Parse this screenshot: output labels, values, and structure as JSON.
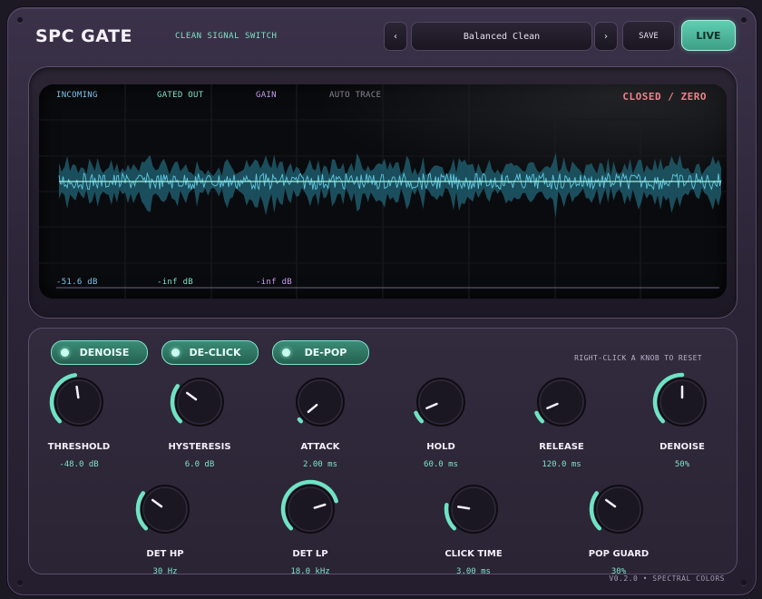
{
  "header": {
    "title": "SPC GATE",
    "subtitle": "CLEAN SIGNAL SWITCH",
    "prev_icon": "chevron-left-icon",
    "prev_label": "‹",
    "preset": "Balanced Clean",
    "next_icon": "chevron-right-icon",
    "next_label": "›",
    "save_label": "SAVE",
    "live_label": "LIVE"
  },
  "scope": {
    "labels": {
      "incoming": "INCOMING",
      "gated_out": "GATED OUT",
      "gain": "GAIN",
      "auto_trace": "AUTO TRACE"
    },
    "state": "CLOSED / ZERO",
    "readouts": {
      "incoming": "-51.6 dB",
      "gated_out": "-inf dB",
      "gain": "-inf dB"
    }
  },
  "toggles": [
    {
      "label": "DENOISE",
      "on": true
    },
    {
      "label": "DE-CLICK",
      "on": true
    },
    {
      "label": "DE-POP",
      "on": true
    }
  ],
  "hint": "RIGHT-CLICK A KNOB TO RESET",
  "knobs_row1": [
    {
      "name": "THRESHOLD",
      "value": "-48.0 dB",
      "level": 0.47
    },
    {
      "name": "HYSTERESIS",
      "value": "6.0 dB",
      "level": 0.3
    },
    {
      "name": "ATTACK",
      "value": "2.00 ms",
      "level": 0.02
    },
    {
      "name": "HOLD",
      "value": "60.0 ms",
      "level": 0.08
    },
    {
      "name": "RELEASE",
      "value": "120.0 ms",
      "level": 0.08
    },
    {
      "name": "DENOISE",
      "value": "50%",
      "level": 0.5
    }
  ],
  "knobs_row2": [
    {
      "name": "DET HP",
      "value": "30 Hz",
      "level": 0.3
    },
    {
      "name": "DET LP",
      "value": "18.0 kHz",
      "level": 0.77
    },
    {
      "name": "CLICK TIME",
      "value": "3.00 ms",
      "level": 0.2
    },
    {
      "name": "POP GUARD",
      "value": "30%",
      "level": 0.3
    }
  ],
  "footer": "V0.2.0  •  SPECTRAL COLORS",
  "colors": {
    "accent": "#6fe3c4",
    "closed_state": "#f0808a",
    "incoming_label": "#7ec3e8",
    "gated_label": "#7fe3c9",
    "gain_label": "#c79ef0",
    "auto_trace_label": "#8a8494"
  }
}
